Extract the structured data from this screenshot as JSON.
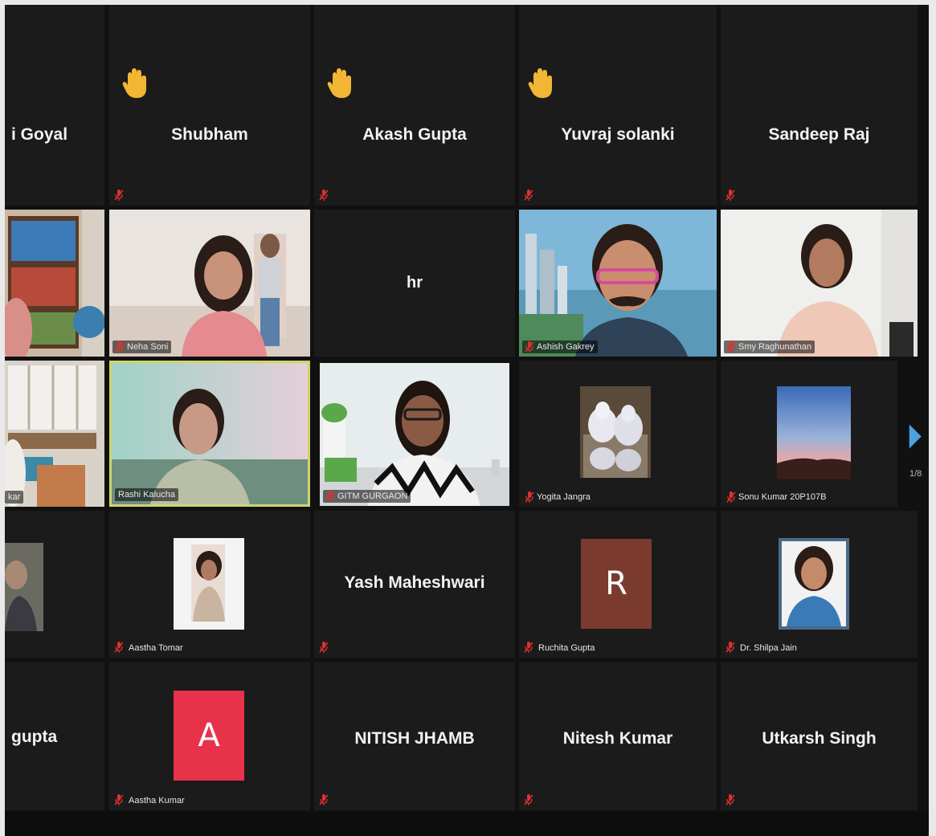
{
  "meeting": {
    "page_indicator": "1/8",
    "tiles": [
      {
        "name": "i Goyal"
      },
      {
        "name": "Shubham",
        "hand_raised": true
      },
      {
        "name": "Akash Gupta",
        "hand_raised": true
      },
      {
        "name": "Yuvraj solanki",
        "hand_raised": true
      },
      {
        "name": "Sandeep Raj"
      },
      {
        "name": ""
      },
      {
        "name": "Neha Soni"
      },
      {
        "name": "hr"
      },
      {
        "name": "Ashish Gakrey"
      },
      {
        "name": "Smy Raghunathan"
      },
      {
        "name": "kar"
      },
      {
        "name": "Rashi Kalucha"
      },
      {
        "name": "GITM GURGAON"
      },
      {
        "name": "Yogita Jangra"
      },
      {
        "name": "Sonu Kumar 20P107B"
      },
      {
        "name": ""
      },
      {
        "name": "Aastha Tomar"
      },
      {
        "name": "Yash Maheshwari"
      },
      {
        "name": "Ruchita Gupta",
        "avatar_letter": "R"
      },
      {
        "name": "Dr. Shilpa Jain"
      },
      {
        "name": "gupta"
      },
      {
        "name": "Aastha Kumar",
        "avatar_letter": "A"
      },
      {
        "name": "NITISH JHAMB"
      },
      {
        "name": "Nitesh Kumar"
      },
      {
        "name": "Utkarsh Singh"
      }
    ]
  },
  "colors": {
    "tile_bg": "#1b1b1b",
    "active_speaker_border": "#cfd46a",
    "muted_mic": "#e03030",
    "raise_hand": "#f2b634",
    "avatar_r": "#7a3b2e",
    "avatar_a": "#e8324a",
    "pager_arrow": "#4aa3df"
  }
}
